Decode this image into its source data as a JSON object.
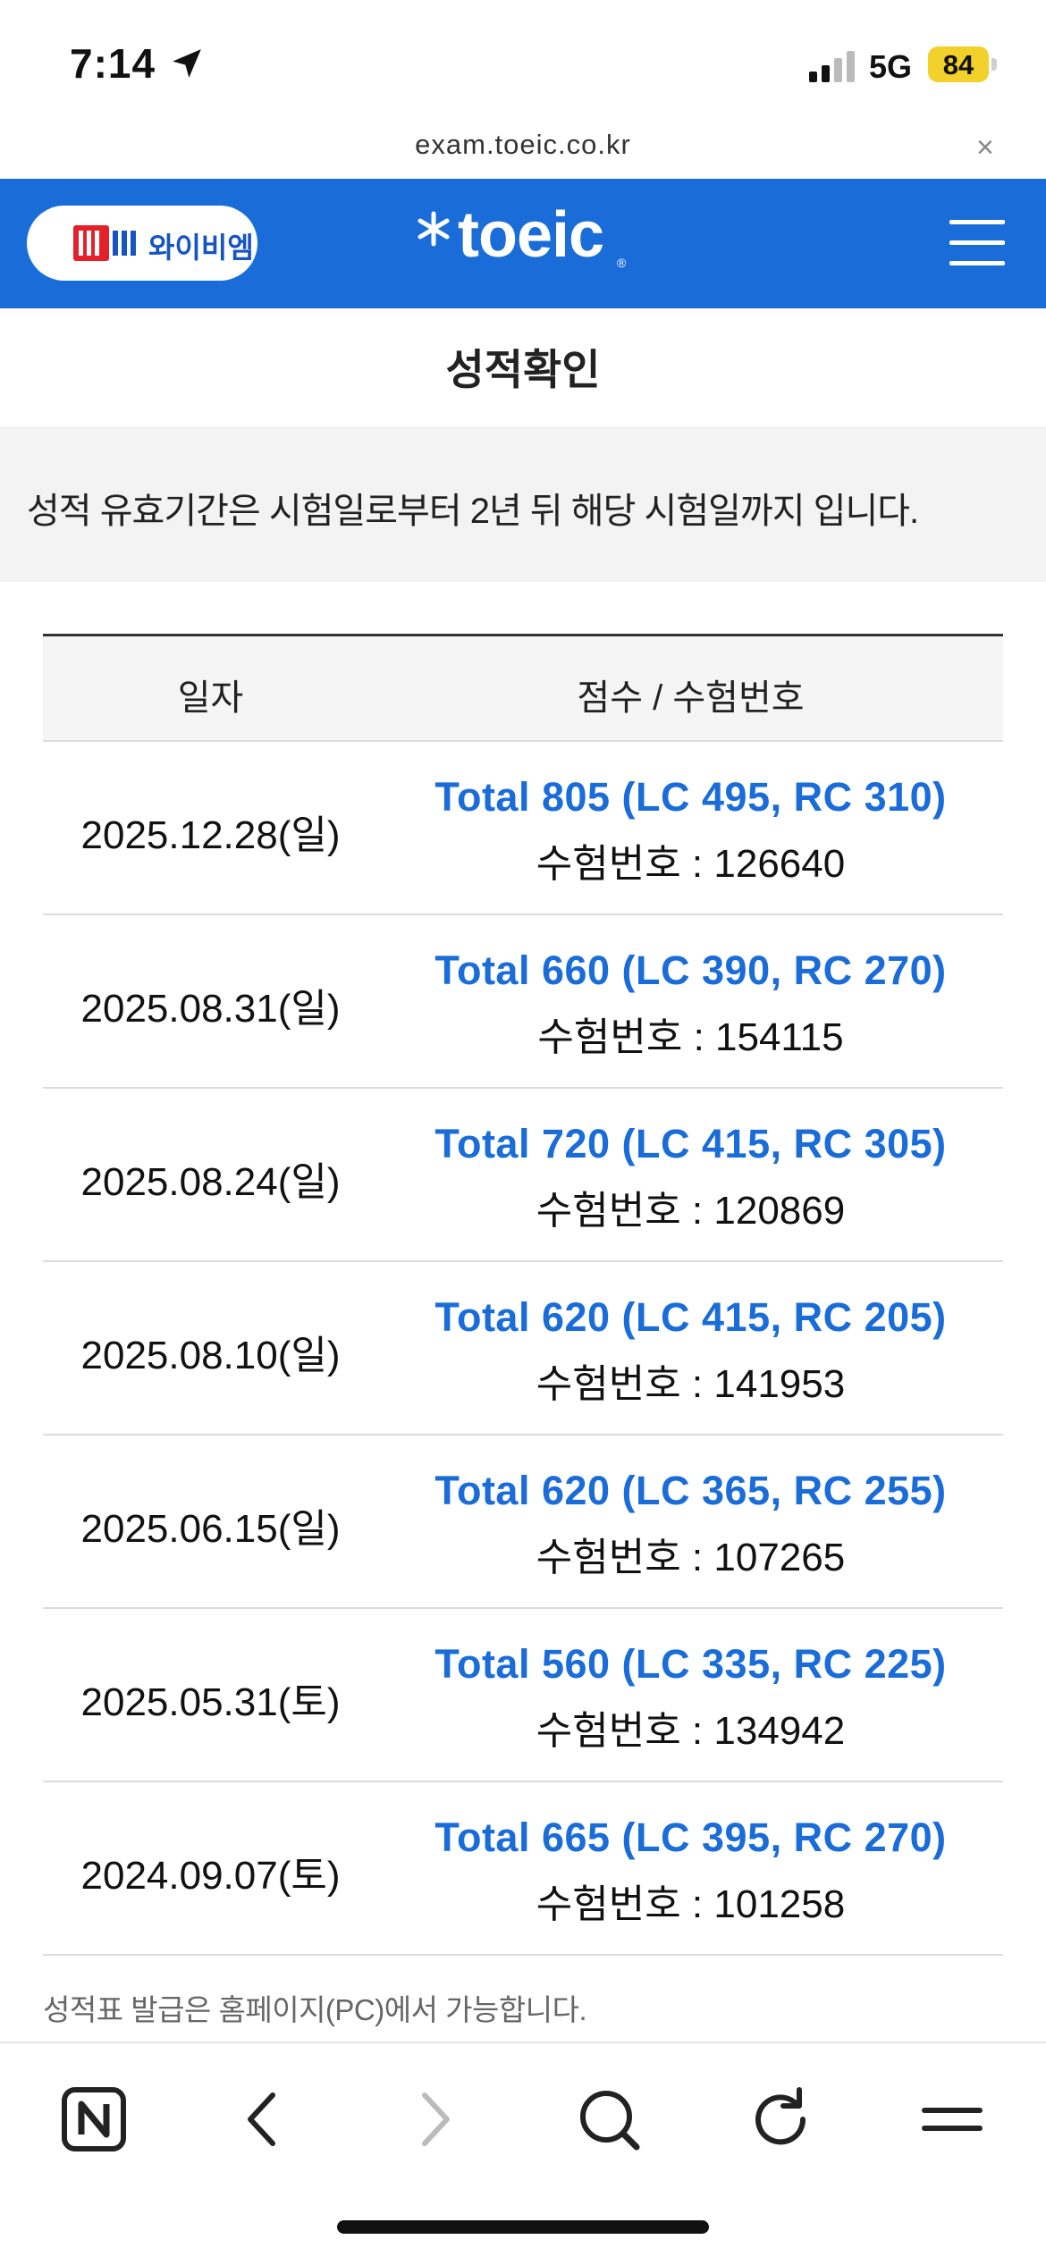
{
  "status_bar": {
    "time": "7:14",
    "network": "5G",
    "battery": "84",
    "battery_color": "#f2d12b"
  },
  "url_bar": {
    "url": "exam.toeic.co.kr",
    "close_glyph": "×"
  },
  "header": {
    "ybm_label": "와이비엠",
    "logo_text": "toeic",
    "brand_color": "#1a6dd9"
  },
  "page": {
    "title": "성적확인",
    "notice": "성적 유효기간은 시험일로부터 2년 뒤 해당 시험일까지 입니다.",
    "footnote": "성적표 발급은 홈페이지(PC)에서 가능합니다."
  },
  "table": {
    "headers": {
      "date": "일자",
      "score": "점수 / 수험번호"
    },
    "rows": [
      {
        "date": "2025.12.28(일)",
        "score": "Total 805 (LC 495, RC 310)",
        "exam_no": "수험번호 : 126640"
      },
      {
        "date": "2025.08.31(일)",
        "score": "Total 660 (LC 390, RC 270)",
        "exam_no": "수험번호 : 154115"
      },
      {
        "date": "2025.08.24(일)",
        "score": "Total 720 (LC 415, RC 305)",
        "exam_no": "수험번호 : 120869"
      },
      {
        "date": "2025.08.10(일)",
        "score": "Total 620 (LC 415, RC 205)",
        "exam_no": "수험번호 : 141953"
      },
      {
        "date": "2025.06.15(일)",
        "score": "Total 620 (LC 365, RC 255)",
        "exam_no": "수험번호 : 107265"
      },
      {
        "date": "2025.05.31(토)",
        "score": "Total 560 (LC 335, RC 225)",
        "exam_no": "수험번호 : 134942"
      },
      {
        "date": "2024.09.07(토)",
        "score": "Total 665 (LC 395, RC 270)",
        "exam_no": "수험번호 : 101258"
      }
    ]
  },
  "toolbar": {
    "icons": [
      "naver-home-icon",
      "back-icon",
      "forward-icon",
      "search-icon",
      "reload-icon",
      "menu-icon"
    ]
  }
}
